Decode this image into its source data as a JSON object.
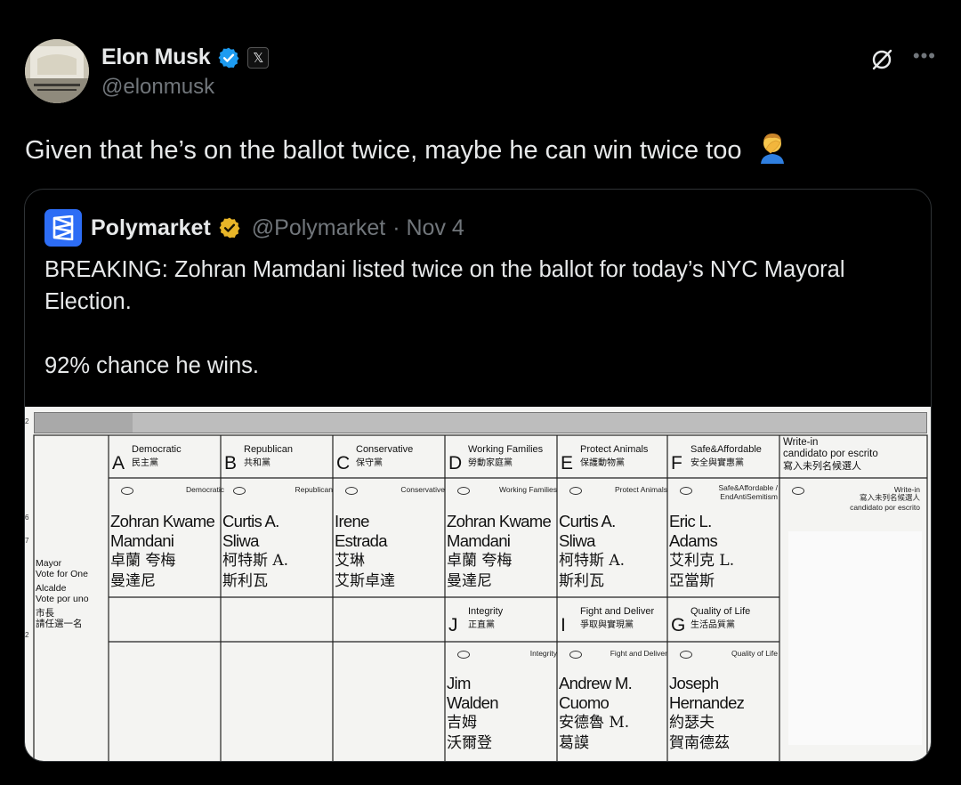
{
  "author": {
    "name": "Elon Musk",
    "handle": "@elonmusk",
    "badge_color": "#1d9bf0"
  },
  "post": {
    "text": "Given that he’s on the ballot twice, maybe he can win twice too"
  },
  "icons": {
    "grok": "grok-icon",
    "more": "more-icon",
    "facepalm": "man-facepalming-emoji"
  },
  "quoted": {
    "name": "Polymarket",
    "handle": "@Polymarket",
    "date": "· Nov 4",
    "line1": "BREAKING: Zohran Mamdani listed twice on the ballot for today’s NYC Mayoral Election.",
    "line2": "92% chance he wins.",
    "badge_color": "#e8b528",
    "logo_color": "#2d6df5"
  },
  "ballot": {
    "office": {
      "en": "Mayor",
      "en_sub": "Vote for One",
      "es": "Alcalde",
      "es_sub": "Vote por uno",
      "zh": "市長",
      "zh_sub": "請任選一名"
    },
    "margin": [
      "2",
      "6",
      "7",
      "2"
    ],
    "columns": [
      {
        "letter": "A",
        "party": "Democratic",
        "party_zh": "民主黨",
        "tag": "Democratic",
        "name1": "Zohran Kwame",
        "name2": "Mamdani",
        "zh1": "卓蘭 夸梅",
        "zh2": "曼達尼"
      },
      {
        "letter": "B",
        "party": "Republican",
        "party_zh": "共和黨",
        "tag": "Republican",
        "name1": "Curtis A.",
        "name2": "Sliwa",
        "zh1": "柯特斯 A.",
        "zh2": "斯利瓦"
      },
      {
        "letter": "C",
        "party": "Conservative",
        "party_zh": "保守黨",
        "tag": "Conservative",
        "name1": "Irene",
        "name2": "Estrada",
        "zh1": "艾琳",
        "zh2": "艾斯卓達"
      },
      {
        "letter": "D",
        "party": "Working Families",
        "party_zh": "勞動家庭黨",
        "tag": "Working Families",
        "name1": "Zohran Kwame",
        "name2": "Mamdani",
        "zh1": "卓蘭 夸梅",
        "zh2": "曼達尼"
      },
      {
        "letter": "E",
        "party": "Protect Animals",
        "party_zh": "保護動物黨",
        "tag": "Protect Animals",
        "name1": "Curtis A.",
        "name2": "Sliwa",
        "zh1": "柯特斯 A.",
        "zh2": "斯利瓦"
      },
      {
        "letter": "F",
        "party": "Safe&Affordable",
        "party_zh": "安全與實惠黨",
        "tag": "Safe&Affordable /",
        "tag2": "EndAntiSemitism",
        "name1": "Eric L.",
        "name2": "Adams",
        "zh1": "艾利克 L.",
        "zh2": "亞當斯"
      }
    ],
    "write_in": {
      "title": "Write-in",
      "es": "candidato por escrito",
      "zh": "寫入未列名候選人",
      "tag1": "Write-in",
      "tag2": "寫入未列名候選人",
      "tag3": "candidato por escrito"
    },
    "row2": [
      {
        "letter": "J",
        "party": "Integrity",
        "party_zh": "正直黨",
        "tag": "Integrity",
        "name1": "Jim",
        "name2": "Walden",
        "zh1": "吉姆",
        "zh2": "沃爾登"
      },
      {
        "letter": "I",
        "party": "Fight and Deliver",
        "party_zh": "爭取與實現黨",
        "tag": "Fight and Deliver",
        "name1": "Andrew M.",
        "name2": "Cuomo",
        "zh1": "安德魯 M.",
        "zh2": "葛謨"
      },
      {
        "letter": "G",
        "party": "Quality of Life",
        "party_zh": "生活品質黨",
        "tag": "Quality of Life",
        "name1": "Joseph",
        "name2": "Hernandez",
        "zh1": "約瑟夫",
        "zh2": "賀南德茲"
      }
    ]
  }
}
